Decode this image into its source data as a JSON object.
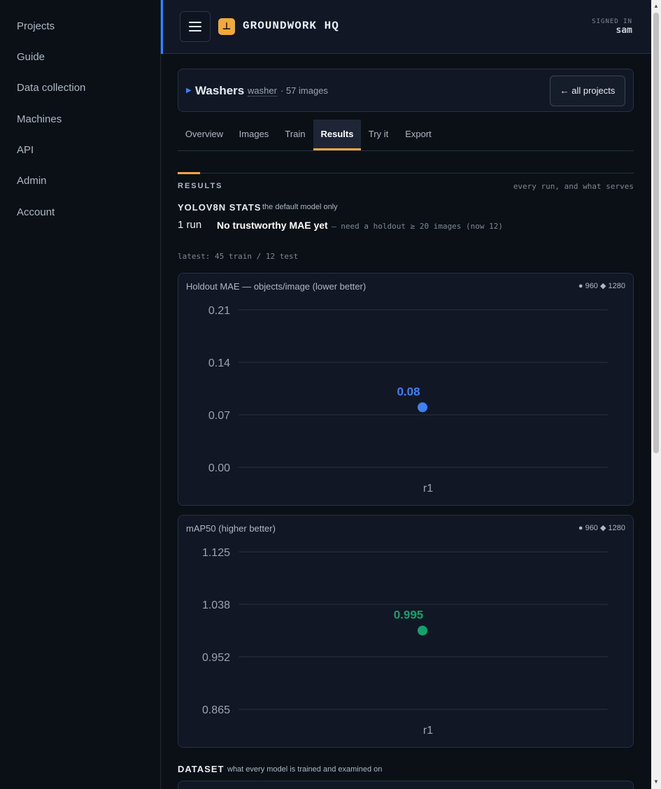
{
  "sidebar": {
    "items": [
      {
        "label": "Projects"
      },
      {
        "label": "Guide"
      },
      {
        "label": "Data collection"
      },
      {
        "label": "Machines"
      },
      {
        "label": "API"
      },
      {
        "label": "Admin"
      },
      {
        "label": "Account"
      }
    ]
  },
  "header": {
    "logo_glyph": "⊥",
    "brand": "GROUNDWORK HQ",
    "signed_in_label": "SIGNED IN",
    "user": "sam",
    "accent_color": "#3b82f6",
    "logo_color": "#f2a93b"
  },
  "project": {
    "name": "Washers",
    "class": "washer",
    "count": "· 57 images",
    "back_label": "← all projects"
  },
  "tabs": [
    {
      "label": "Overview",
      "active": false
    },
    {
      "label": "Images",
      "active": false
    },
    {
      "label": "Train",
      "active": false
    },
    {
      "label": "Results",
      "active": true
    },
    {
      "label": "Try it",
      "active": false
    },
    {
      "label": "Export",
      "active": false
    }
  ],
  "results": {
    "title": "RESULTS",
    "hint": "every run, and what serves",
    "stats_title": "YOLOV8N STATS",
    "stats_sub": "the default model only",
    "runs": "1 run",
    "mae_warning": "No trustworthy MAE yet",
    "mae_note": "— need a holdout ≥ 20 images (now 12)",
    "latest": "latest: 45 train / 12 test"
  },
  "chart_data": [
    {
      "type": "scatter",
      "title": "Holdout MAE — objects/image (lower better)",
      "legend": [
        "● 960",
        "◆ 1280"
      ],
      "categories": [
        "r1"
      ],
      "yticks": [
        "0.21",
        "0.14",
        "0.07",
        "0.00"
      ],
      "ylim": [
        0,
        0.21
      ],
      "series": [
        {
          "name": "960",
          "values": [
            0.08
          ],
          "labels": [
            "0.08"
          ]
        }
      ],
      "color": "#3b82f6"
    },
    {
      "type": "scatter",
      "title": "mAP50 (higher better)",
      "legend": [
        "● 960",
        "◆ 1280"
      ],
      "categories": [
        "r1"
      ],
      "yticks": [
        "1.125",
        "1.038",
        "0.952",
        "0.865"
      ],
      "ylim": [
        0.865,
        1.125
      ],
      "series": [
        {
          "name": "960",
          "values": [
            0.995
          ],
          "labels": [
            "0.995"
          ]
        }
      ],
      "color": "#10a36e"
    }
  ],
  "dataset": {
    "title": "DATASET",
    "sub": "what every model is trained and examined on"
  }
}
